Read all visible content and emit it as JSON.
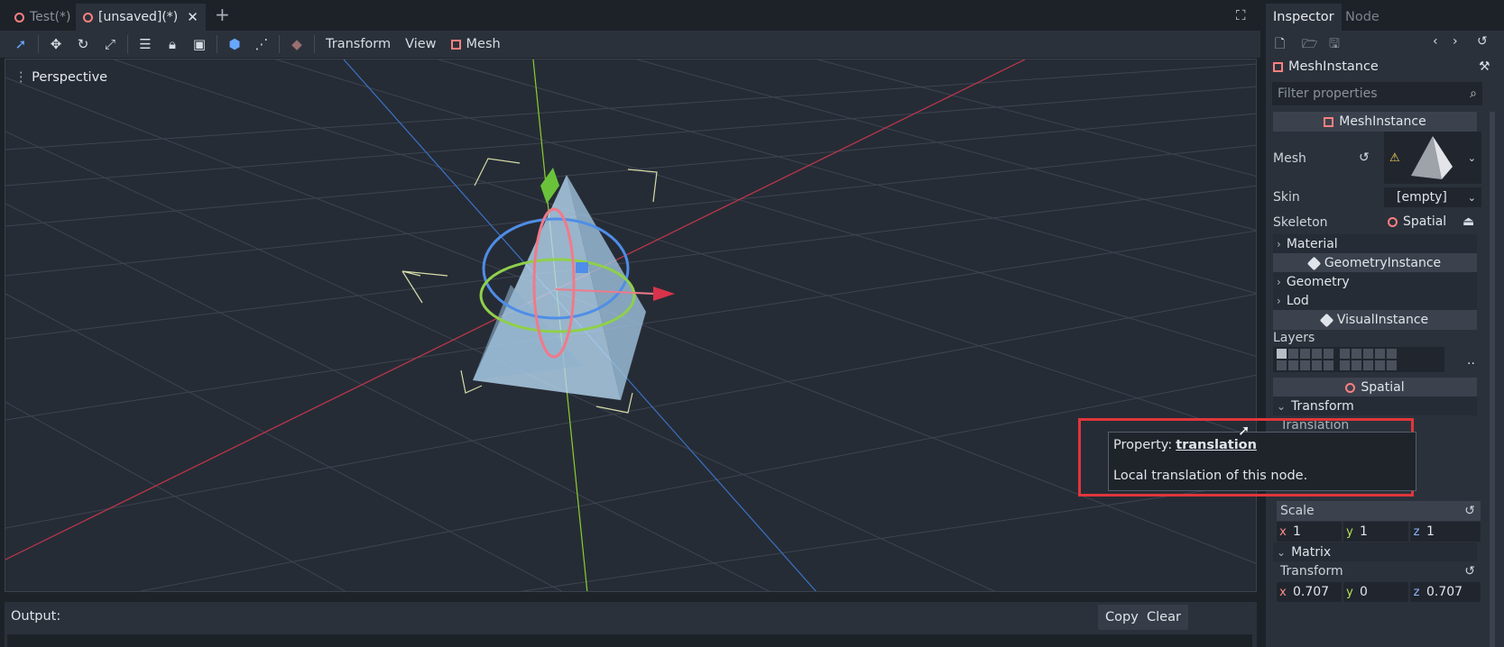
{
  "editor": {
    "tabs": [
      {
        "label": "Test(*)"
      },
      {
        "label": "[unsaved](*)"
      }
    ],
    "add_tab": "+",
    "toolbar_menus": {
      "transform": "Transform",
      "view": "View",
      "mesh": "Mesh"
    },
    "viewport_label": "Perspective"
  },
  "output": {
    "label": "Output:",
    "copy": "Copy",
    "clear": "Clear"
  },
  "inspector": {
    "tabs": {
      "inspector": "Inspector",
      "node": "Node"
    },
    "node_name": "MeshInstance",
    "filter_placeholder": "Filter properties",
    "sections": {
      "meshinstance": "MeshInstance",
      "geometryinstance": "GeometryInstance",
      "visualinstance": "VisualInstance",
      "spatial": "Spatial"
    },
    "props": {
      "mesh": "Mesh",
      "skin": "Skin",
      "skin_value": "[empty]",
      "skeleton": "Skeleton",
      "skeleton_value": "Spatial",
      "material": "Material",
      "geometry": "Geometry",
      "lod": "Lod",
      "layers": "Layers",
      "layers_more": "..",
      "transform": "Transform",
      "translation": "Translation",
      "scale": "Scale",
      "matrix": "Matrix",
      "matrix_transform": "Transform"
    },
    "scale_values": {
      "x": "1",
      "y": "1",
      "z": "1"
    },
    "matrix_values": {
      "x": "0.707",
      "y": "0",
      "z": "0.707"
    },
    "axis_labels": {
      "x": "x",
      "y": "y",
      "z": "z"
    }
  },
  "tooltip": {
    "prefix": "Property:",
    "name": "translation",
    "description": "Local translation of this node."
  }
}
